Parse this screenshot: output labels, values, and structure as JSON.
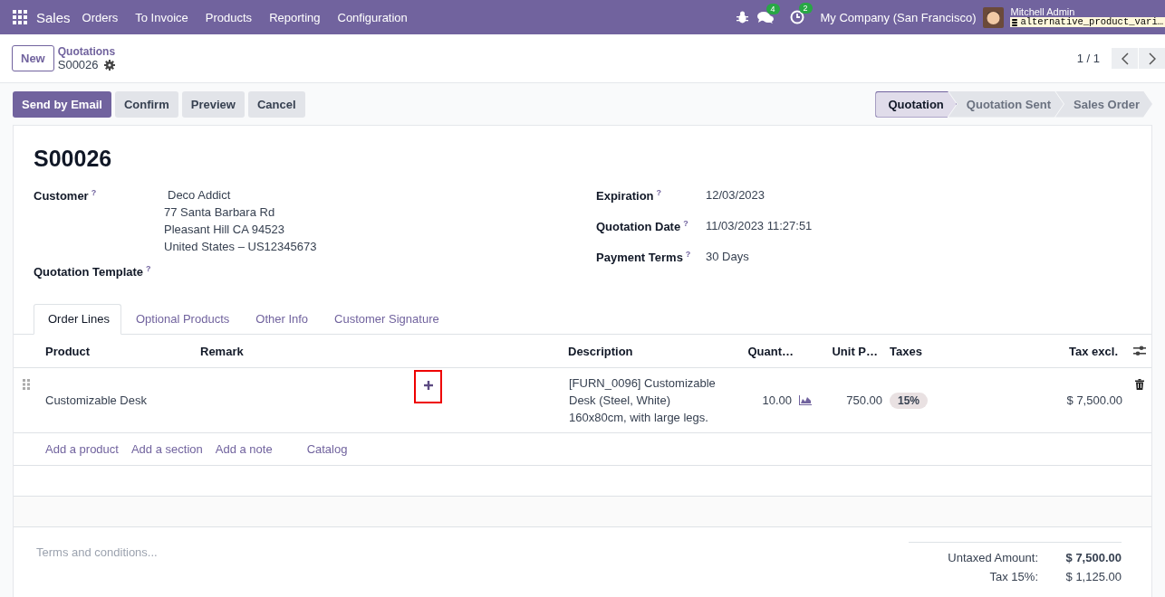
{
  "navbar": {
    "app_name": "Sales",
    "menu": [
      "Orders",
      "To Invoice",
      "Products",
      "Reporting",
      "Configuration"
    ],
    "messages_count": "4",
    "activities_count": "2",
    "company": "My Company (San Francisco)",
    "user": "Mitchell Admin",
    "database": "alternative_product_vari…"
  },
  "control_panel": {
    "new_button": "New",
    "breadcrumb_parent": "Quotations",
    "breadcrumb_current": "S00026",
    "pager": "1 / 1"
  },
  "actions": [
    {
      "label": "Send by Email",
      "kind": "primary"
    },
    {
      "label": "Confirm",
      "kind": "secondary"
    },
    {
      "label": "Preview",
      "kind": "secondary"
    },
    {
      "label": "Cancel",
      "kind": "secondary"
    }
  ],
  "status_steps": [
    {
      "label": "Quotation",
      "selected": true
    },
    {
      "label": "Quotation Sent",
      "selected": false
    },
    {
      "label": "Sales Order",
      "selected": false
    }
  ],
  "form": {
    "title": "S00026",
    "left_fields": [
      {
        "label": "Customer",
        "help": "?",
        "lines": [
          "Deco Addict",
          "77 Santa Barbara Rd",
          "Pleasant Hill CA 94523",
          "United States – US12345673"
        ]
      },
      {
        "label": "Quotation Template",
        "help": "?"
      }
    ],
    "right_fields": [
      {
        "label": "Expiration",
        "help": "?",
        "lines": [
          "12/03/2023"
        ]
      },
      {
        "label": "Quotation Date",
        "help": "?",
        "lines": [
          "11/03/2023 11:27:51"
        ]
      },
      {
        "label": "Payment Terms",
        "help": "?",
        "lines": [
          "30 Days"
        ]
      }
    ]
  },
  "tabs": [
    {
      "label": "Order Lines",
      "selected": true
    },
    {
      "label": "Optional Products",
      "selected": false
    },
    {
      "label": "Other Info",
      "selected": false
    },
    {
      "label": "Customer Signature",
      "selected": false
    }
  ],
  "table": {
    "columns": [
      "Product",
      "Remark",
      "Description",
      "Quant…",
      "Unit P…",
      "Taxes",
      "Tax excl."
    ],
    "rows": [
      {
        "product": "Customizable Desk",
        "description": [
          "[FURN_0096] Customizable",
          "Desk (Steel, White)",
          "160x80cm, with large legs."
        ],
        "quantity": "10.00",
        "unit_price": "750.00",
        "taxes": "15%",
        "subtotal": "$ 7,500.00"
      }
    ],
    "add_links": [
      "Add a product",
      "Add a section",
      "Add a note",
      "Catalog"
    ]
  },
  "terms_placeholder": "Terms and conditions...",
  "totals": [
    {
      "label": "Untaxed Amount:",
      "value": "$ 7,500.00",
      "kind": "bold"
    },
    {
      "label": "Tax 15%:",
      "value": "$ 1,125.00",
      "kind": "plain"
    }
  ]
}
